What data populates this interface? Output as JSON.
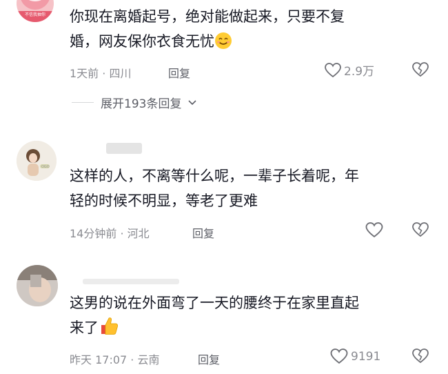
{
  "comments": [
    {
      "text_line1": "你现在离婚起号，绝对能做起来，只要不复",
      "text_line2": "婚，网友保你衣食无忧",
      "time_location": "1天前 · 四川",
      "reply_label": "回复",
      "like_count": "2.9万",
      "avatar_caption": "不信我抽你",
      "emoji": "smiling-face-emoji"
    },
    {
      "text_line1": "这样的人，不离等什么呢，一辈子长着呢，年",
      "text_line2": "轻的时候不明显，等老了更难",
      "time_location": "14分钟前 · 河北",
      "reply_label": "回复",
      "like_count": ""
    },
    {
      "text_line1": "这男的说在外面弯了一天的腰终于在家里直起",
      "text_line2": "来了",
      "time_location": "昨天 17:07 · 云南",
      "reply_label": "回复",
      "like_count": "9191",
      "emoji": "thumbs-up-emoji"
    }
  ],
  "expand_replies": {
    "label": "展开193条回复"
  },
  "colors": {
    "text": "#161823",
    "meta": "#8a8b91",
    "reply": "#5c5e66",
    "divider": "#d6d7da"
  }
}
